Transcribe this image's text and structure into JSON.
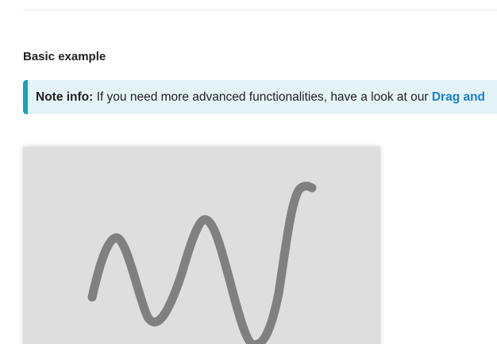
{
  "section": {
    "title": "Basic example"
  },
  "note": {
    "label": "Note info:",
    "text": " If you need more advanced functionalities, have a look at our ",
    "link": "Drag and"
  },
  "drawing": {
    "background_color": "#dedede",
    "stroke_color": "#808080"
  },
  "colors": {
    "note_background": "#e4f4f6",
    "note_accent": "#17a2b8",
    "link": "#1b7fd1"
  }
}
